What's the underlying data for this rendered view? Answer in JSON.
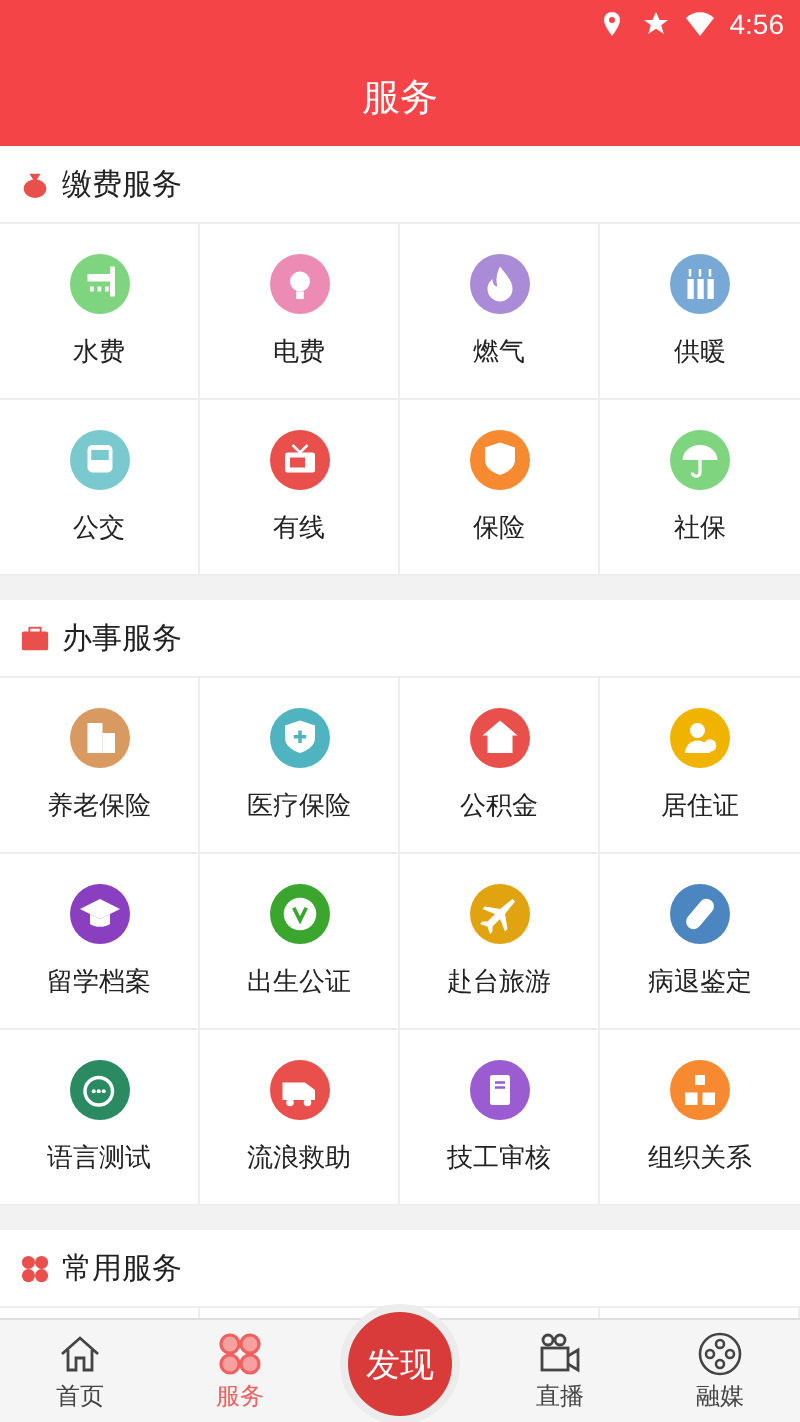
{
  "status_bar": {
    "time": "4:56"
  },
  "header": {
    "title": "服务"
  },
  "sections": [
    {
      "title": "缴费服务",
      "items": [
        {
          "label": "水费",
          "color": "#7fd47f"
        },
        {
          "label": "电费",
          "color": "#ec8cb5"
        },
        {
          "label": "燃气",
          "color": "#a98bd8"
        },
        {
          "label": "供暖",
          "color": "#78a9d6"
        },
        {
          "label": "公交",
          "color": "#79c9cf"
        },
        {
          "label": "有线",
          "color": "#e9504b"
        },
        {
          "label": "保险",
          "color": "#f78a30"
        },
        {
          "label": "社保",
          "color": "#7fd47f"
        }
      ]
    },
    {
      "title": "办事服务",
      "items": [
        {
          "label": "养老保险",
          "color": "#d99a62"
        },
        {
          "label": "医疗保险",
          "color": "#4fb4c0"
        },
        {
          "label": "公积金",
          "color": "#e9504b"
        },
        {
          "label": "居住证",
          "color": "#f0b400"
        },
        {
          "label": "留学档案",
          "color": "#8a3fc0"
        },
        {
          "label": "出生公证",
          "color": "#3aa62e"
        },
        {
          "label": "赴台旅游",
          "color": "#e2a310"
        },
        {
          "label": "病退鉴定",
          "color": "#4b86c0"
        },
        {
          "label": "语言测试",
          "color": "#2a8a62"
        },
        {
          "label": "流浪救助",
          "color": "#e9504b"
        },
        {
          "label": "技工审核",
          "color": "#9a5cd0"
        },
        {
          "label": "组织关系",
          "color": "#f78a30"
        }
      ]
    },
    {
      "title": "常用服务"
    }
  ],
  "tabs": [
    {
      "label": "首页",
      "kind": "tab",
      "selected": false
    },
    {
      "label": "服务",
      "kind": "tab",
      "selected": true
    },
    {
      "label": "发现",
      "kind": "center",
      "selected": false
    },
    {
      "label": "直播",
      "kind": "tab",
      "selected": false
    },
    {
      "label": "融媒",
      "kind": "tab",
      "selected": false
    }
  ]
}
